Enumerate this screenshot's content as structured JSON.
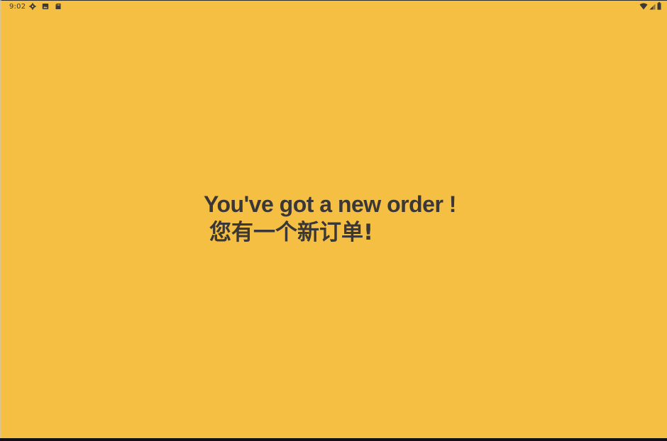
{
  "status_bar": {
    "time": "9:02",
    "left_icons": [
      "settings-icon",
      "photo-icon",
      "sd-card-icon"
    ],
    "right_icons": [
      "wifi-icon",
      "signal-icon",
      "battery-icon"
    ]
  },
  "message": {
    "english": "You've got a new order !",
    "chinese": "您有一个新订单!"
  },
  "colors": {
    "background": "#f4bf42",
    "text": "#3b3736"
  }
}
